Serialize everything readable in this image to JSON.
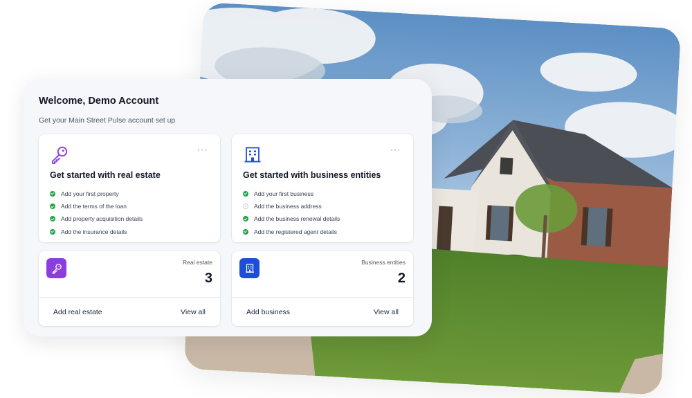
{
  "welcome_title": "Welcome, Demo Account",
  "subtitle": "Get your Main Street Pulse account set up",
  "colors": {
    "accent_purple": "#8b3ddf",
    "accent_blue": "#1d4ed8",
    "check_green": "#22a34a"
  },
  "real_estate_card": {
    "icon": "key-icon",
    "more_label": "···",
    "title": "Get started with real estate",
    "items": [
      {
        "label": "Add your first property",
        "status": "done"
      },
      {
        "label": "Add the terms of the loan",
        "status": "done"
      },
      {
        "label": "Add property acquisition details",
        "status": "done"
      },
      {
        "label": "Add the insurance details",
        "status": "done"
      }
    ]
  },
  "business_card": {
    "icon": "building-icon",
    "more_label": "···",
    "title": "Get started with business entities",
    "items": [
      {
        "label": "Add your first business",
        "status": "done"
      },
      {
        "label": "Add the business address",
        "status": "pending"
      },
      {
        "label": "Add the business renewal details",
        "status": "done"
      },
      {
        "label": "Add the registered agent details",
        "status": "done"
      }
    ]
  },
  "real_estate_stat": {
    "icon": "key-icon",
    "label": "Real estate",
    "value": "3",
    "add_label": "Add real estate",
    "view_label": "View all"
  },
  "business_stat": {
    "icon": "building-icon",
    "label": "Business entities",
    "value": "2",
    "add_label": "Add business",
    "view_label": "View all"
  },
  "background_image": "house-photo"
}
